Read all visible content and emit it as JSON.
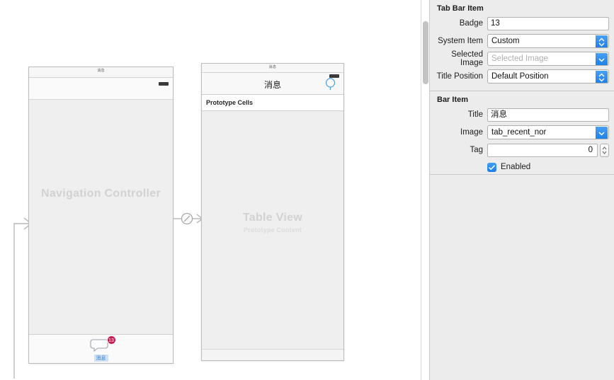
{
  "canvas": {
    "nav_scene": {
      "statusbar_title": "消息",
      "center_label": "Navigation Controller",
      "tab_item": {
        "badge": "13",
        "title": "消息"
      }
    },
    "table_scene": {
      "statusbar_title": "消息",
      "navbar_title": "消息",
      "prototype_header": "Prototype Cells",
      "center_label": "Table View",
      "center_sublabel": "Prototype Content"
    }
  },
  "inspector": {
    "tab_bar_item": {
      "section_title": "Tab Bar Item",
      "badge_label": "Badge",
      "badge_value": "13",
      "system_item_label": "System Item",
      "system_item_value": "Custom",
      "selected_image_label": "Selected Image",
      "selected_image_placeholder": "Selected Image",
      "title_position_label": "Title Position",
      "title_position_value": "Default Position"
    },
    "bar_item": {
      "section_title": "Bar Item",
      "title_label": "Title",
      "title_value": "消息",
      "image_label": "Image",
      "image_value": "tab_recent_nor",
      "tag_label": "Tag",
      "tag_value": "0",
      "enabled_label": "Enabled",
      "enabled_checked": true
    }
  },
  "colors": {
    "accent_blue": "#2b8ef0",
    "badge_red": "#c41e4e",
    "panel_bg": "#ececec",
    "scene_body": "#efefef"
  }
}
